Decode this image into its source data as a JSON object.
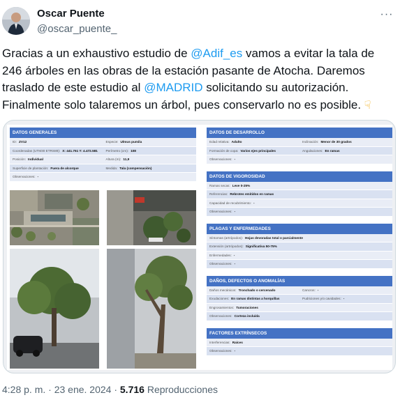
{
  "user": {
    "name": "Oscar Puente",
    "handle": "@oscar_puente_"
  },
  "tweet": {
    "p1": "Gracias a un exhaustivo estudio de ",
    "m1": "@Adif_es",
    "p2": " vamos a evitar la tala de 246 árboles en las obras de la estación pasante de Atocha. Daremos traslado de este estudio al ",
    "m2": "@MADRID",
    "p3": " solicitando su autorización. Finalmente solo talaremos un árbol, pues conservarlo no es posible. ",
    "emoji_icon": "backhand-index-pointing-down"
  },
  "doc": {
    "general": {
      "title": "DATOS GENERALES",
      "rows": [
        [
          [
            "ID:",
            "ZV12"
          ],
          [
            "Especie:",
            "Ulmus pumila"
          ]
        ],
        [
          [
            "Coordenadas (UTM30 ETRS89):",
            "X: 441.761  Y: 4.472.581"
          ],
          [
            "Perímetro (cm):",
            "108"
          ]
        ],
        [
          [
            "Posición:",
            "Individual"
          ],
          [
            "Altura (m):",
            "11,9"
          ]
        ],
        [
          [
            "Superficie de plantación:",
            "Fuera de alcorque"
          ],
          [
            "Medida:",
            "Tala (compensación)"
          ]
        ],
        [
          [
            "Observaciones:",
            "-"
          ]
        ]
      ]
    },
    "desarrollo": {
      "title": "DATOS DE DESARROLLO",
      "rows": [
        [
          [
            "Edad relativa:",
            "Adulto"
          ],
          [
            "Inclinación:",
            "Menor de 30 grados"
          ]
        ],
        [
          [
            "Formación de copa:",
            "Varios ejes principales"
          ],
          [
            "Angulaciones:",
            "En ramas"
          ]
        ],
        [
          [
            "Observaciones:",
            "-"
          ]
        ]
      ]
    },
    "vigorosidad": {
      "title": "DATOS DE VIGOROSIDAD",
      "rows": [
        [
          [
            "Ramas secas:",
            "Leve 0-25%"
          ]
        ],
        [
          [
            "Referencias:",
            "Rebrotes emitidos en ramas"
          ]
        ],
        [
          [
            "Capacidad de recubrimiento:",
            "-"
          ]
        ],
        [
          [
            "Observaciones:",
            "-"
          ]
        ]
      ]
    },
    "plagas": {
      "title": "PLAGAS Y ENFERMEDADES",
      "rows": [
        [
          [
            "Síntomas (artrópodos):",
            "Hojas devoradas total o parcialmente"
          ]
        ],
        [
          [
            "Extensión (artrópodos):",
            "Significativa 50-75%"
          ]
        ],
        [
          [
            "Enfermedades:",
            "-"
          ]
        ],
        [
          [
            "Observaciones:",
            "-"
          ]
        ]
      ]
    },
    "danos": {
      "title": "DAÑOS, DEFECTOS O ANOMALÍAS",
      "rows": [
        [
          [
            "Daños mecánicos:",
            "Tronchado o cercenado"
          ],
          [
            "Cancros:",
            "-"
          ]
        ],
        [
          [
            "Exudaciones:",
            "En ramas distintas a horquillas"
          ],
          [
            "Pudriciones y/o cavidades:",
            "-"
          ]
        ],
        [
          [
            "Engrosamientos:",
            "Tumoraciones"
          ]
        ],
        [
          [
            "Observaciones:",
            "Corteza incluida"
          ]
        ]
      ]
    },
    "extrinsecos": {
      "title": "FACTORES EXTRÍNSECOS",
      "rows": [
        [
          [
            "Interferencias:",
            "Raíces"
          ]
        ],
        [
          [
            "Observaciones:",
            "-"
          ]
        ]
      ]
    }
  },
  "footer": {
    "time": "4:28 p. m. · 23 ene. 2024 · ",
    "views_count": "5.716",
    "views_label": " Reproducciones"
  }
}
